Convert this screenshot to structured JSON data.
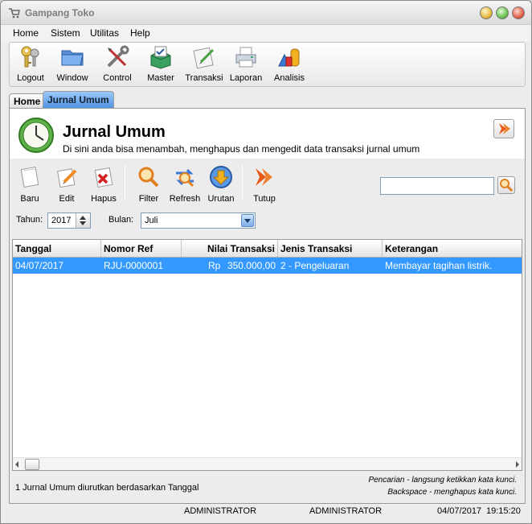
{
  "window": {
    "title": "Gampang Toko"
  },
  "menu": [
    "Home",
    "Sistem",
    "Utilitas",
    "Help"
  ],
  "toolbar": [
    {
      "label": "Logout",
      "icon": "keys-icon"
    },
    {
      "label": "Window",
      "icon": "folder-icon"
    },
    {
      "label": "Control",
      "icon": "tools-icon"
    },
    {
      "label": "Master",
      "icon": "box-icon"
    },
    {
      "label": "Transaksi",
      "icon": "notepad-icon"
    },
    {
      "label": "Laporan",
      "icon": "printer-icon"
    },
    {
      "label": "Analisis",
      "icon": "chart-icon"
    }
  ],
  "tabs": {
    "home": "Home",
    "active": "Jurnal Umum"
  },
  "header": {
    "title": "Jurnal Umum",
    "subtitle": "Di sini anda bisa menambah, menghapus dan mengedit data transaksi jurnal umum"
  },
  "actions": {
    "baru": "Baru",
    "edit": "Edit",
    "hapus": "Hapus",
    "filter": "Filter",
    "refresh": "Refresh",
    "urutan": "Urutan",
    "tutup": "Tutup"
  },
  "search": {
    "value": ""
  },
  "filters": {
    "tahun_label": "Tahun:",
    "tahun_value": "2017",
    "bulan_label": "Bulan:",
    "bulan_value": "Juli"
  },
  "table": {
    "columns": [
      "Tanggal",
      "Nomor Ref",
      "Nilai Transaksi",
      "Jenis Transaksi",
      "Keterangan"
    ],
    "rows": [
      {
        "tanggal": "04/07/2017",
        "nomor_ref": "RJU-0000001",
        "currency": "Rp",
        "nilai": "350.000,00",
        "jenis": "2 - Pengeluaran",
        "keterangan": "Membayar tagihan listrik."
      }
    ]
  },
  "footer": {
    "status": "1 Jurnal Umum diurutkan berdasarkan Tanggal",
    "hint_search": "Pencarian - langsung ketikkan kata kunci.",
    "hint_backspace": "Backspace - menghapus kata kunci."
  },
  "statusbar": {
    "user1": "ADMINISTRATOR",
    "user2": "ADMINISTRATOR",
    "date": "04/07/2017",
    "time": "19:15:20"
  },
  "colors": {
    "selection": "#3399ff",
    "tab_active": "#4b8fe0"
  }
}
